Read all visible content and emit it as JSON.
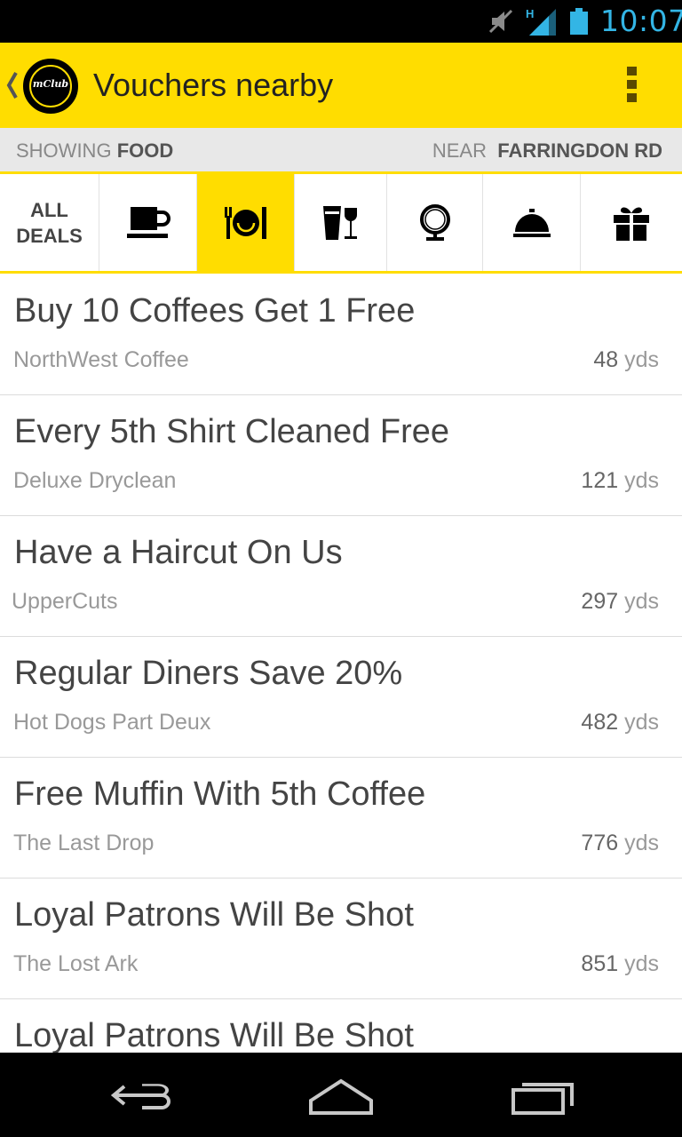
{
  "status_bar": {
    "time": "10:07",
    "network": "H",
    "icons": [
      "mute-icon",
      "signal-icon",
      "battery-icon"
    ],
    "accent_color": "#33b5e5"
  },
  "action_bar": {
    "logo_text": "mClub",
    "title": "Vouchers nearby",
    "background_color": "#ffdd00"
  },
  "filter": {
    "showing_label": "SHOWING",
    "showing_value": "FOOD",
    "near_label": "NEAR",
    "near_value": "FARRINGDON RD"
  },
  "categories": [
    {
      "label_line1": "ALL",
      "label_line2": "DEALS",
      "icon": "all-deals",
      "selected": false
    },
    {
      "icon": "coffee-cup-icon",
      "selected": false
    },
    {
      "icon": "plate-cutlery-icon",
      "selected": true
    },
    {
      "icon": "drinks-icon",
      "selected": false
    },
    {
      "icon": "mirror-icon",
      "selected": false
    },
    {
      "icon": "cloche-icon",
      "selected": false
    },
    {
      "icon": "gift-icon",
      "selected": false
    }
  ],
  "vouchers": [
    {
      "title": "Buy 10 Coffees Get 1 Free",
      "place": "NorthWest Coffee",
      "distance": "48",
      "unit": "yds"
    },
    {
      "title": "Every 5th Shirt Cleaned Free",
      "place": "Deluxe Dryclean",
      "distance": "121",
      "unit": "yds"
    },
    {
      "title": "Have a Haircut On Us",
      "place": "UpperCuts",
      "distance": "297",
      "unit": "yds"
    },
    {
      "title": "Regular Diners Save 20%",
      "place": "Hot Dogs Part Deux",
      "distance": "482",
      "unit": "yds"
    },
    {
      "title": "Free Muffin With 5th Coffee",
      "place": "The Last Drop",
      "distance": "776",
      "unit": "yds"
    },
    {
      "title": "Loyal Patrons Will Be Shot",
      "place": "The Lost Ark",
      "distance": "851",
      "unit": "yds"
    },
    {
      "title": "Loyal Patrons Will Be Shot",
      "place": "",
      "distance": "",
      "unit": ""
    }
  ],
  "nav_bar": {
    "buttons": [
      "back-icon",
      "home-icon",
      "recent-apps-icon"
    ]
  }
}
